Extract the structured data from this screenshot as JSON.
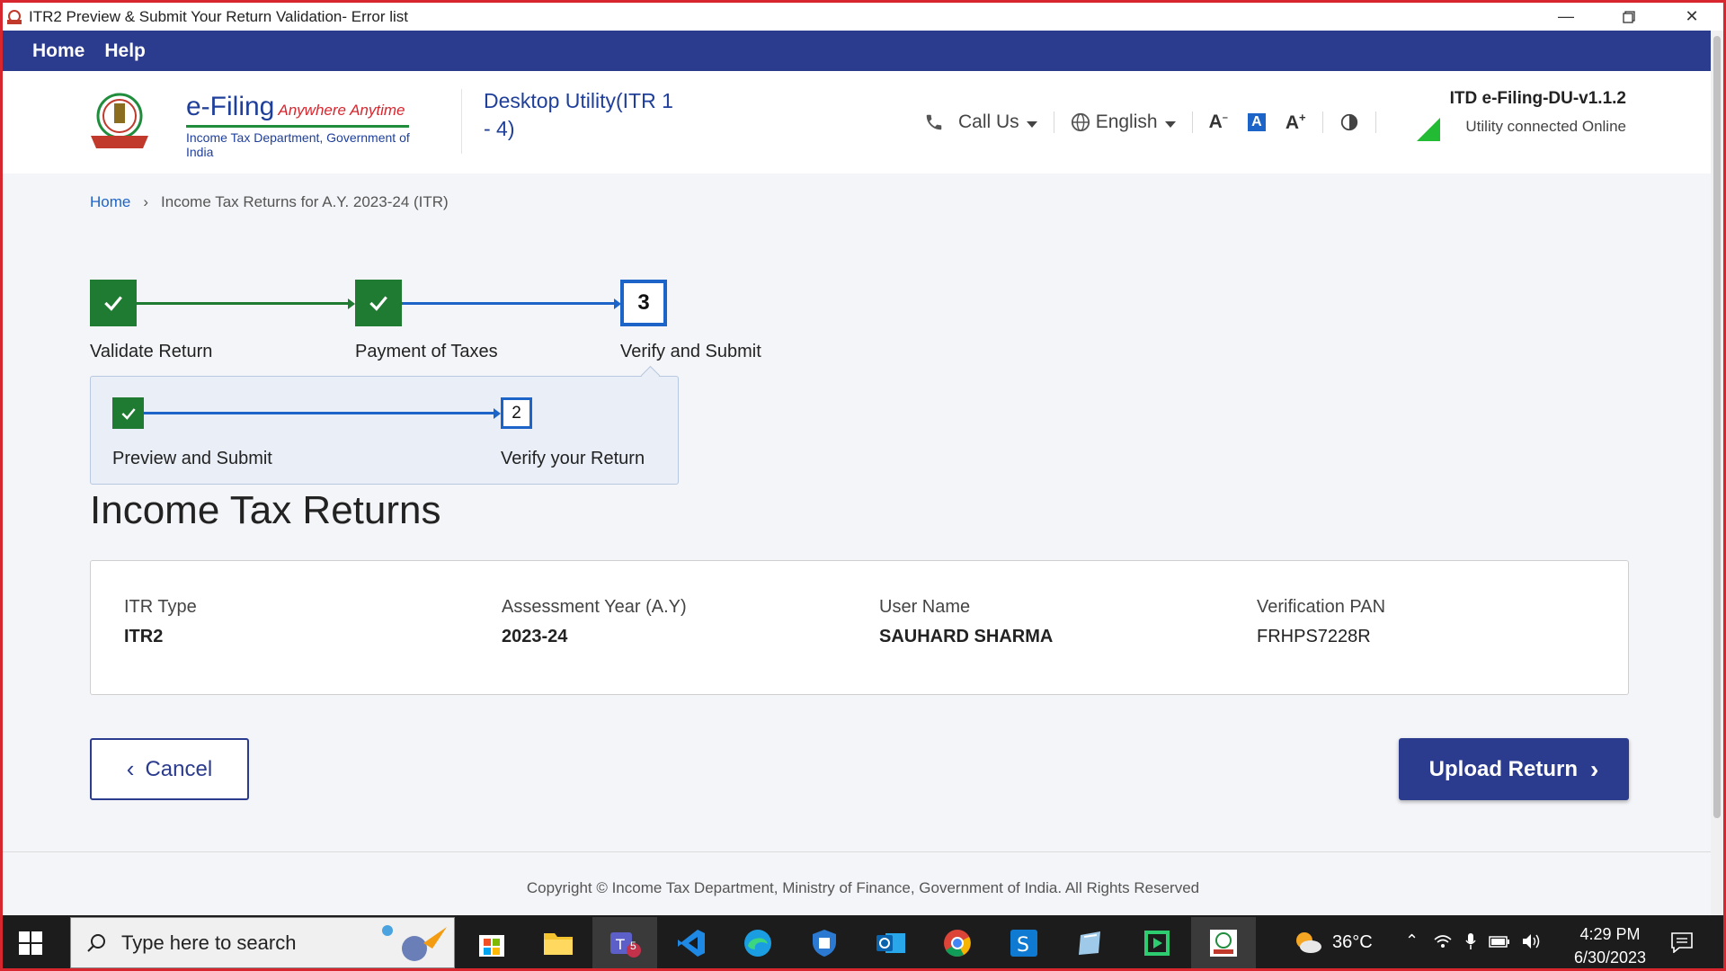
{
  "window": {
    "title": "ITR2 Preview & Submit Your Return Validation- Error list",
    "controls": [
      "minimize-icon",
      "restore-icon",
      "close-icon"
    ]
  },
  "nav": {
    "items": [
      "Home",
      "Help"
    ]
  },
  "header": {
    "logo_title": "e-Filing",
    "logo_tagline": "Anywhere Anytime",
    "logo_subtitle": "Income Tax Department, Government of India",
    "logo_emblem_text": "INCOME TAX DEPARTMENT",
    "app_name": "Desktop Utility(ITR 1 - 4)",
    "call_us": "Call Us",
    "language": "English",
    "font_decrease": "A",
    "font_default": "A",
    "font_increase": "A",
    "version": "ITD e-Filing-DU-v1.1.2",
    "connection_status": "Utility connected Online"
  },
  "breadcrumb": {
    "home": "Home",
    "current": "Income Tax Returns for A.Y. 2023-24 (ITR)"
  },
  "stepper": {
    "steps": [
      {
        "label": "Validate Return",
        "status": "done"
      },
      {
        "label": "Payment of Taxes",
        "status": "done"
      },
      {
        "label": "Verify and Submit",
        "status": "active",
        "number": "3"
      }
    ],
    "substeps": [
      {
        "label": "Preview and Submit",
        "status": "done"
      },
      {
        "label": "Verify your Return",
        "status": "active",
        "number": "2"
      }
    ]
  },
  "page_title": "Income Tax Returns",
  "info": {
    "itr_type_label": "ITR Type",
    "itr_type_value": "ITR2",
    "ay_label": "Assessment Year (A.Y)",
    "ay_value": "2023-24",
    "user_label": "User Name",
    "user_value": "SAUHARD SHARMA",
    "pan_label": "Verification PAN",
    "pan_value": "FRHPS7228R"
  },
  "actions": {
    "cancel": "Cancel",
    "upload": "Upload Return"
  },
  "footer": {
    "copyright": "Copyright © Income Tax Department, Ministry of Finance, Government of India. All Rights Reserved"
  },
  "taskbar": {
    "search_placeholder": "Type here to search",
    "teams_badge": "5",
    "temperature": "36°C",
    "time": "4:29 PM",
    "date": "6/30/2023"
  },
  "colors": {
    "primary": "#2b3b8e",
    "link": "#1d64c8",
    "done": "#1f7a32",
    "window_border": "#d7262e"
  }
}
